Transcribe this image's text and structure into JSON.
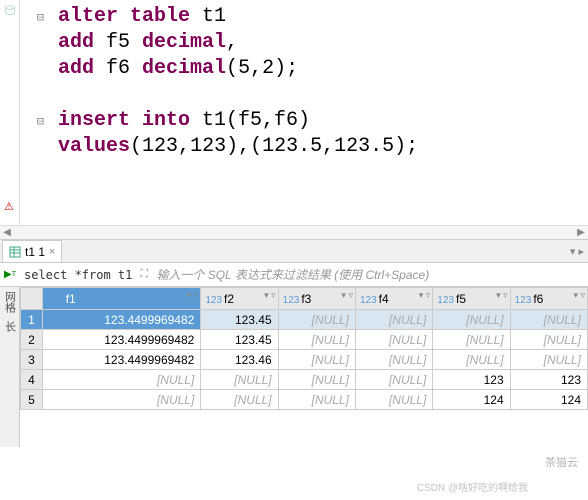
{
  "editor": {
    "lines": [
      {
        "fold": true,
        "tokens": [
          {
            "t": "alter table",
            "c": "kw"
          },
          {
            "t": " t1",
            "c": "p"
          }
        ]
      },
      {
        "fold": false,
        "tokens": [
          {
            "t": "add",
            "c": "kw"
          },
          {
            "t": " f5 ",
            "c": "p"
          },
          {
            "t": "decimal",
            "c": "kw"
          },
          {
            "t": ",",
            "c": "p"
          }
        ]
      },
      {
        "fold": false,
        "tokens": [
          {
            "t": "add",
            "c": "kw"
          },
          {
            "t": " f6 ",
            "c": "p"
          },
          {
            "t": "decimal",
            "c": "kw"
          },
          {
            "t": "(",
            "c": "p"
          },
          {
            "t": "5",
            "c": "n"
          },
          {
            "t": ",",
            "c": "p"
          },
          {
            "t": "2",
            "c": "n"
          },
          {
            "t": ");",
            "c": "p"
          }
        ]
      },
      {
        "fold": false,
        "tokens": []
      },
      {
        "fold": true,
        "tokens": [
          {
            "t": "insert into",
            "c": "kw"
          },
          {
            "t": " t1(f5,f6)",
            "c": "p"
          }
        ]
      },
      {
        "fold": false,
        "tokens": [
          {
            "t": "values",
            "c": "kw"
          },
          {
            "t": "(",
            "c": "p"
          },
          {
            "t": "123",
            "c": "n"
          },
          {
            "t": ",",
            "c": "p"
          },
          {
            "t": "123",
            "c": "n"
          },
          {
            "t": "),(",
            "c": "p"
          },
          {
            "t": "123.5",
            "c": "n"
          },
          {
            "t": ",",
            "c": "p"
          },
          {
            "t": "123.5",
            "c": "n"
          },
          {
            "t": ");",
            "c": "p"
          }
        ]
      }
    ]
  },
  "tab": {
    "label": "t1 1",
    "close": "×"
  },
  "filter": {
    "sql": "select *from t1",
    "hint": "输入一个 SQL 表达式来过滤结果 (使用 Ctrl+Space)"
  },
  "grid": {
    "columns": [
      "f1",
      "f2",
      "f3",
      "f4",
      "f5",
      "f6"
    ],
    "left_labels": [
      "网格",
      "长"
    ],
    "rows": [
      {
        "n": "1",
        "sel": true,
        "cells": [
          "123.4499969482",
          "123.45",
          "[NULL]",
          "[NULL]",
          "[NULL]",
          "[NULL]"
        ]
      },
      {
        "n": "2",
        "cells": [
          "123.4499969482",
          "123.45",
          "[NULL]",
          "[NULL]",
          "[NULL]",
          "[NULL]"
        ]
      },
      {
        "n": "3",
        "cells": [
          "123.4499969482",
          "123.46",
          "[NULL]",
          "[NULL]",
          "[NULL]",
          "[NULL]"
        ]
      },
      {
        "n": "4",
        "cells": [
          "[NULL]",
          "[NULL]",
          "[NULL]",
          "[NULL]",
          "123",
          "123"
        ]
      },
      {
        "n": "5",
        "cells": [
          "[NULL]",
          "[NULL]",
          "[NULL]",
          "[NULL]",
          "124",
          "124"
        ]
      }
    ]
  },
  "watermark": "茶猫云",
  "watermark2": "CSDN @啥好吃的啊给我"
}
